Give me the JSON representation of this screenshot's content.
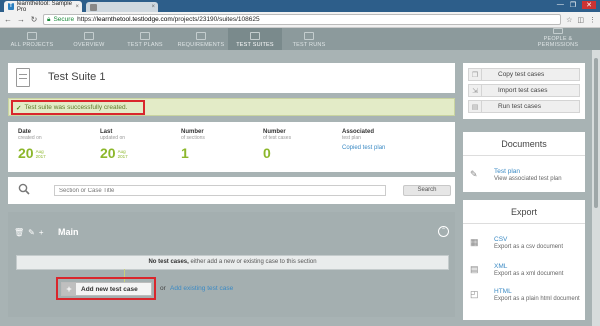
{
  "browser": {
    "active_tab_title": "learnthetool: Sample Pro",
    "inactive_tab_title": "",
    "tab_close": "×",
    "secure_label": "Secure",
    "url_prefix": "https://",
    "url_host": "learnthetool.testlodge.com",
    "url_path": "/projects/23190/suites/108625",
    "window_controls": [
      "—",
      "❐",
      "✕"
    ]
  },
  "nav": {
    "items": [
      {
        "label": "ALL PROJECTS",
        "active": false
      },
      {
        "label": "OVERVIEW",
        "active": false
      },
      {
        "label": "TEST PLANS",
        "active": false
      },
      {
        "label": "REQUIREMENTS",
        "active": false
      },
      {
        "label": "TEST SUITES",
        "active": true
      },
      {
        "label": "TEST RUNS",
        "active": false
      }
    ],
    "right_label": "PEOPLE & PERMISSIONS"
  },
  "suite": {
    "title": "Test Suite 1"
  },
  "banner": {
    "message": "Test suite was successfully created."
  },
  "stats": {
    "date": {
      "label": "Date",
      "sub": "created on",
      "day": "20",
      "month": "Aug",
      "year": "2017"
    },
    "last": {
      "label": "Last",
      "sub": "updated on",
      "day": "20",
      "month": "Aug",
      "year": "2017"
    },
    "sections": {
      "label": "Number",
      "sub": "of sections",
      "value": "1"
    },
    "cases": {
      "label": "Number",
      "sub": "of test cases",
      "value": "0"
    },
    "associated": {
      "label": "Associated",
      "sub": "test plan",
      "link": "Copied test plan"
    }
  },
  "search": {
    "placeholder": "Section or Case Title",
    "button_label": "Search"
  },
  "section": {
    "title": "Main",
    "empty_bold": "No test cases,",
    "empty_rest": " either add a new or existing case to this section",
    "add_button_label": "Add new test case",
    "or_label": "or",
    "existing_link": "Add existing test case"
  },
  "actions": [
    {
      "label": "Copy test cases",
      "icon": "copy-icon"
    },
    {
      "label": "Import test cases",
      "icon": "import-icon"
    },
    {
      "label": "Run test cases",
      "icon": "run-icon"
    }
  ],
  "documents": {
    "heading": "Documents",
    "items": [
      {
        "title": "Test plan",
        "desc": "View associated test plan",
        "icon": "document-icon"
      }
    ]
  },
  "export": {
    "heading": "Export",
    "items": [
      {
        "title": "CSV",
        "desc": "Export as a csv document",
        "icon": "csv-icon"
      },
      {
        "title": "XML",
        "desc": "Export as a xml document",
        "icon": "xml-icon"
      },
      {
        "title": "HTML",
        "desc": "Export as a plain html document",
        "icon": "html-icon"
      }
    ]
  },
  "colors": {
    "accent_green": "#8cb72b",
    "link_blue": "#3b8ac4",
    "highlight_red": "#d9262c",
    "banner_bg": "#e3ebc7"
  }
}
